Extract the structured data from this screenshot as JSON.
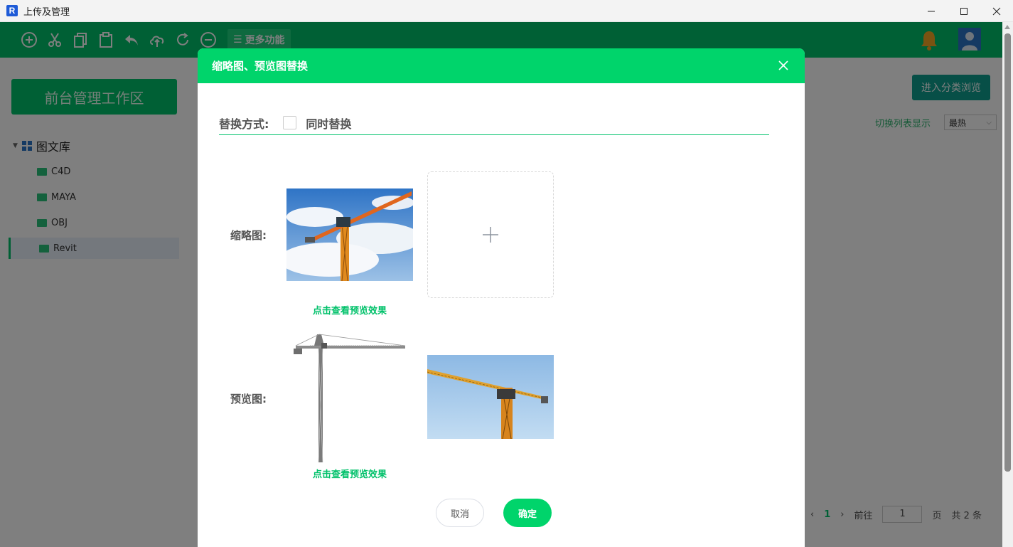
{
  "window": {
    "title": "上传及管理",
    "app_icon_letter": "R"
  },
  "toolbar": {
    "icons": [
      "add-circle-icon",
      "cut-icon",
      "copy-icon",
      "paste-icon",
      "undo-icon",
      "cloud-upload-icon",
      "redo-icon",
      "remove-circle-icon"
    ],
    "more_label": "更多功能"
  },
  "sidebar": {
    "header": "前台管理工作区",
    "root_label": "图文库",
    "items": [
      {
        "label": "C4D"
      },
      {
        "label": "MAYA"
      },
      {
        "label": "OBJ"
      },
      {
        "label": "Revit"
      }
    ]
  },
  "main": {
    "browse_button": "进入分类浏览",
    "switch_link": "切换列表显示",
    "sort_value": "最热",
    "pager": {
      "current": "1",
      "goto_label": "前往",
      "goto_value": "1",
      "page_unit": "页",
      "total": "共 2 条"
    }
  },
  "dialog": {
    "title": "缩略图、预览图替换",
    "mode_label": "替换方式:",
    "mode_checkbox_label": "同时替换",
    "mode_checked": false,
    "thumbnail_label": "缩略图:",
    "preview_label": "预览图:",
    "preview_link": "点击查看预览效果",
    "cancel": "取消",
    "confirm": "确定"
  },
  "colors": {
    "brand_green": "#00d46b",
    "toolbar_green": "#00c16a",
    "link_green": "#00c16a"
  }
}
